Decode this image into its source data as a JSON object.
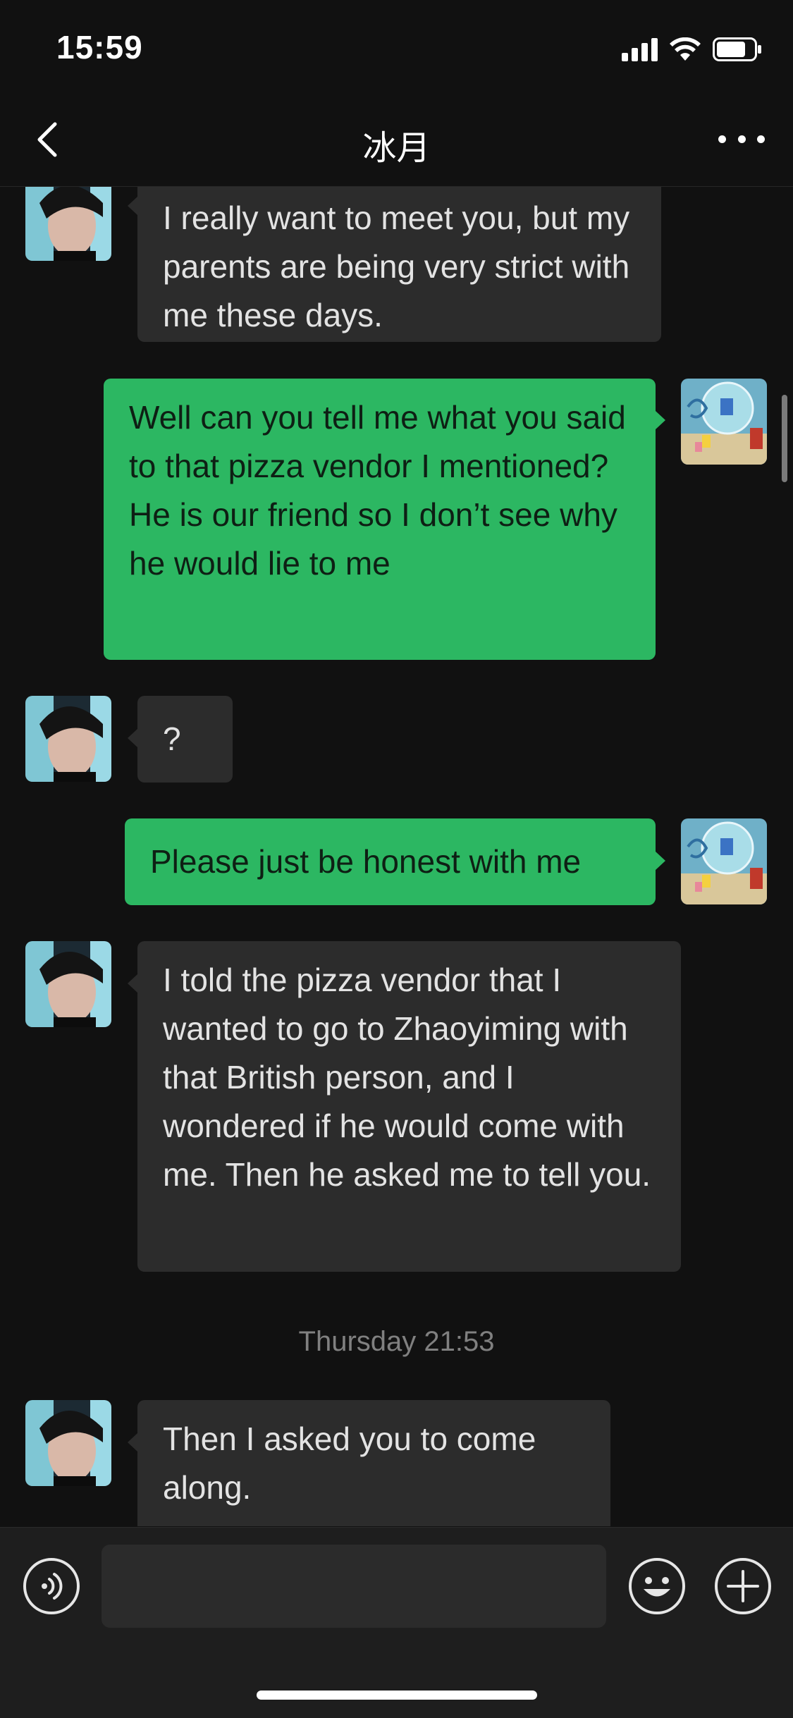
{
  "status_bar": {
    "time": "15:59"
  },
  "nav": {
    "title": "冰月"
  },
  "messages": [
    {
      "from": "contact",
      "text": "I really want to meet you, but my parents are being very strict with me these days."
    },
    {
      "from": "me",
      "text": "Well can you tell me what you said to that pizza vendor I mentioned? He is our friend so I don’t see why he would lie to me"
    },
    {
      "from": "contact",
      "text": "?"
    },
    {
      "from": "me",
      "text": "Please just be honest with me"
    },
    {
      "from": "contact",
      "text": "I told the pizza vendor that I wanted to go to Zhaoyiming with that British person, and I wondered if he would come with me. Then he asked me to tell you."
    },
    {
      "from": "contact",
      "text": "Then I asked you to come along."
    }
  ],
  "timestamp": "Thursday 21:53",
  "input": {
    "value": "",
    "placeholder": ""
  },
  "colors": {
    "background": "#111111",
    "incoming_bubble": "#2c2c2c",
    "outgoing_bubble": "#2cb762"
  }
}
